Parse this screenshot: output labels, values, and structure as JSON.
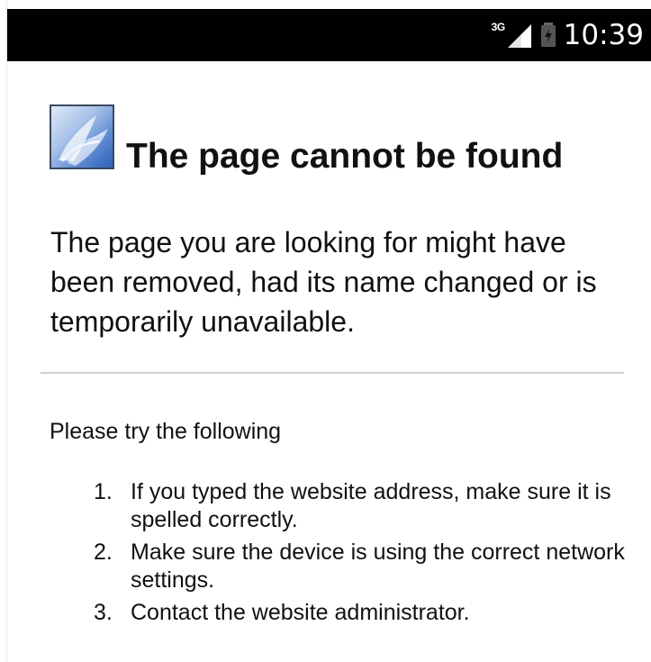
{
  "status_bar": {
    "network_type": "3G",
    "time": "10:39",
    "signal_icon": "signal-bars-icon",
    "battery_icon": "battery-charging-icon"
  },
  "error_page": {
    "logo_icon": "app-logo-icon",
    "title": "The page cannot be found",
    "message": "The page you are looking for might have been removed, had its name changed or is temporarily unavailable.",
    "suggestions_heading": "Please try the following",
    "suggestions": [
      {
        "number": "1.",
        "text": "If you typed the website address, make sure it is spelled correctly."
      },
      {
        "number": "2.",
        "text": "Make sure the device is using the correct network settings."
      },
      {
        "number": "3.",
        "text": "Contact the website administrator."
      }
    ]
  },
  "colors": {
    "status_bar_background": "#000000",
    "page_background": "#ffffff",
    "divider": "#cfcfcf",
    "logo_blue": "#2f5fb6"
  }
}
